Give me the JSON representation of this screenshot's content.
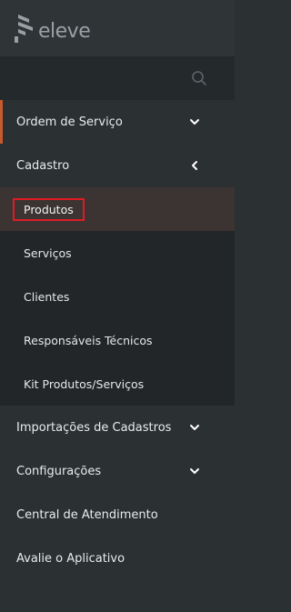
{
  "brand": {
    "name": "eleve"
  },
  "search": {
    "icon": "search-icon"
  },
  "menu": [
    {
      "label": "Ordem de Serviço",
      "icon": "chevron-down-icon"
    },
    {
      "label": "Cadastro",
      "icon": "chevron-left-icon"
    }
  ],
  "cadastro_sub": [
    {
      "label": "Produtos"
    },
    {
      "label": "Serviços"
    },
    {
      "label": "Clientes"
    },
    {
      "label": "Responsáveis Técnicos"
    },
    {
      "label": "Kit Produtos/Serviços"
    }
  ],
  "menu_bottom": [
    {
      "label": "Importações de Cadastros",
      "icon": "chevron-down-icon"
    },
    {
      "label": "Configurações",
      "icon": "chevron-down-icon"
    },
    {
      "label": "Central de Atendimento"
    },
    {
      "label": "Avalie o Aplicativo"
    }
  ],
  "colors": {
    "sidebar_bg": "#2b3033",
    "submenu_bg": "#222628",
    "accent": "#c65a2c",
    "highlight_box": "#e01b24"
  }
}
